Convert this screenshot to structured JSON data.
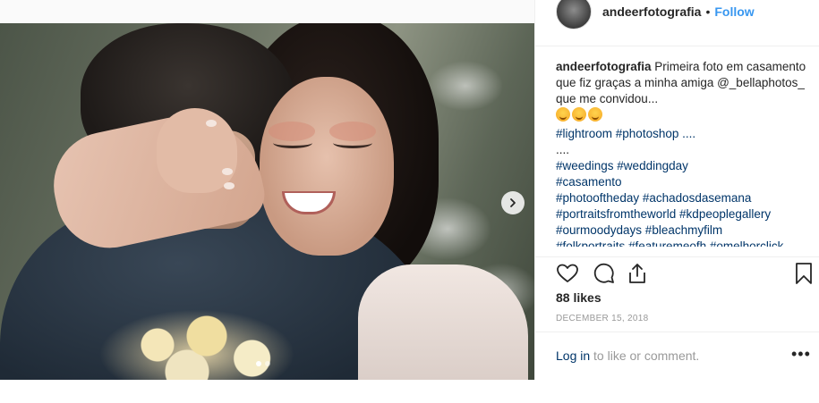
{
  "header": {
    "username": "andeerfotografia",
    "separator": "•",
    "follow_label": "Follow"
  },
  "caption": {
    "username": "andeerfotografia",
    "text": " Primeira foto em casamento que fiz graças a minha amiga @_bellaphotos_ que me convidou...",
    "line_tags_1": "#lightroom #photoshop ....",
    "dots": "....",
    "tags": [
      "#weedings #weddingday",
      "#casamento",
      "#photooftheday #achadosdasemana",
      "#portraitsfromtheworld #kdpeoplegallery",
      "#ourmoodydays #bleachmyfilm",
      "#folkportraits #featuremeofh #omelhorclick"
    ]
  },
  "likes": "88 likes",
  "date": "DECEMBER 15, 2018",
  "footer": {
    "login_label": "Log in",
    "login_suffix": " to like or comment.",
    "more_label": "•••"
  },
  "icons": {
    "like": "heart-icon",
    "comment": "comment-icon",
    "share": "share-icon",
    "save": "bookmark-icon",
    "next": "chevron-right-icon"
  },
  "colors": {
    "link_blue": "#3897f0",
    "hashtag": "#003569",
    "muted": "#999999"
  }
}
